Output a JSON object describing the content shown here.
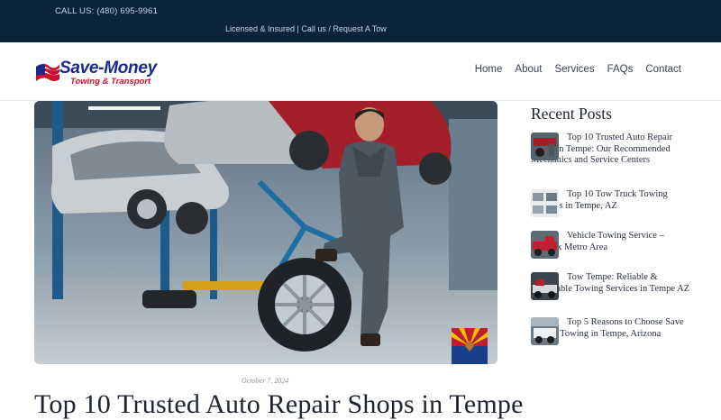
{
  "topbar": {
    "phone": "CALL US: (480) 695-9961",
    "tagline": "Licensed & Insured | Call us / Request A Tow"
  },
  "logo": {
    "brand": "Save-Money",
    "sub": "Towing & Transport"
  },
  "nav": {
    "items": [
      "Home",
      "About",
      "Services",
      "FAQs",
      "Contact"
    ]
  },
  "post": {
    "date": "October 7, 2024",
    "title": "Top 10 Trusted Auto Repair Shops in Tempe"
  },
  "sidebar": {
    "title": "Recent Posts",
    "posts": [
      {
        "title": "Top 10 Trusted Auto Repair Shops in Tempe: Our Recommended Mechanics and Service Centers",
        "thumb": "garage-thumbnail"
      },
      {
        "title": "Top 10 Tow Truck Towing Services in Tempe, AZ",
        "thumb": "tow-truck-grid-thumbnail"
      },
      {
        "title": "Vehicle Towing Service – Phoenix Metro Area",
        "thumb": "red-tow-truck-thumbnail"
      },
      {
        "title": "Tow Tempe: Reliable & Affordable Towing Services in Tempe AZ",
        "thumb": "tow-truck-night-thumbnail"
      },
      {
        "title": "Top 5 Reasons to Choose Save Money Towing in Tempe, Arizona",
        "thumb": "white-tow-truck-thumbnail"
      }
    ]
  },
  "colors": {
    "topbar": "#0c2340",
    "brand_blue": "#1a2a8c",
    "brand_red": "#c8102e"
  }
}
